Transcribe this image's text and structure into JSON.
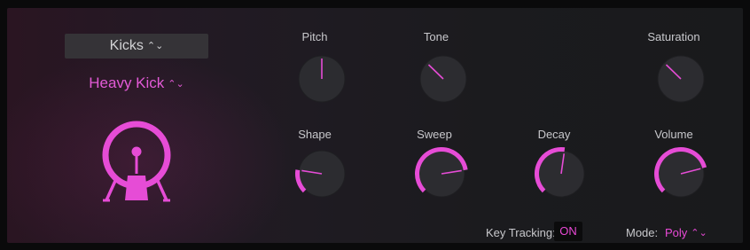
{
  "instrument": {
    "kit_selector": {
      "value": "Kicks"
    },
    "preset_selector": {
      "value": "Heavy Kick"
    },
    "drum_icon": "kick-drum-icon"
  },
  "knobs": [
    {
      "id": "pitch",
      "label": "Pitch",
      "value": 0.5,
      "arc": false
    },
    {
      "id": "tone",
      "label": "Tone",
      "value": 0.33,
      "arc": false
    },
    {
      "id": "saturation",
      "label": "Saturation",
      "value": 0.33,
      "arc": false
    },
    {
      "id": "shape",
      "label": "Shape",
      "value": 0.2,
      "arc": true
    },
    {
      "id": "sweep",
      "label": "Sweep",
      "value": 0.8,
      "arc": true
    },
    {
      "id": "decay",
      "label": "Decay",
      "value": 0.53,
      "arc": true
    },
    {
      "id": "volume",
      "label": "Volume",
      "value": 0.78,
      "arc": true
    }
  ],
  "key_tracking": {
    "label": "Key Tracking:",
    "value": "ON"
  },
  "mode": {
    "label": "Mode:",
    "value": "Poly"
  },
  "colors": {
    "accent": "#e64cd6",
    "knob_body": "#2c2c30",
    "label_text": "#c8c8cc"
  }
}
